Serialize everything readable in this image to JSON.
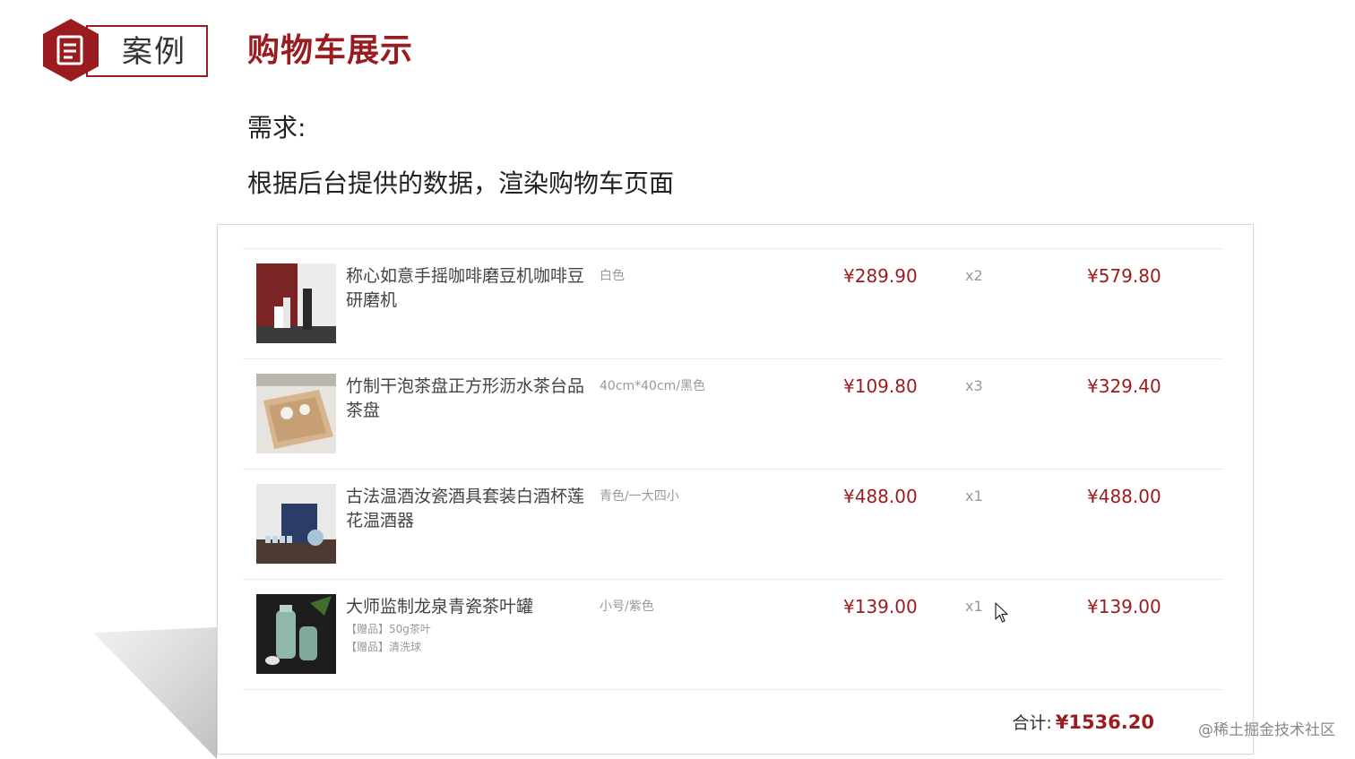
{
  "header": {
    "badge_label": "案例",
    "title": "购物车展示"
  },
  "requirement": {
    "label": "需求:",
    "text": "根据后台提供的数据，渲染购物车页面"
  },
  "cart": {
    "items": [
      {
        "name": "称心如意手摇咖啡磨豆机咖啡豆研磨机",
        "spec": "白色",
        "price": "¥289.90",
        "qty": "x2",
        "subtotal": "¥579.80",
        "gifts": []
      },
      {
        "name": "竹制干泡茶盘正方形沥水茶台品茶盘",
        "spec": "40cm*40cm/黑色",
        "price": "¥109.80",
        "qty": "x3",
        "subtotal": "¥329.40",
        "gifts": []
      },
      {
        "name": "古法温酒汝瓷酒具套装白酒杯莲花温酒器",
        "spec": "青色/一大四小",
        "price": "¥488.00",
        "qty": "x1",
        "subtotal": "¥488.00",
        "gifts": []
      },
      {
        "name": "大师监制龙泉青瓷茶叶罐",
        "spec": "小号/紫色",
        "price": "¥139.00",
        "qty": "x1",
        "subtotal": "¥139.00",
        "gifts": [
          "【赠品】50g茶叶",
          "【赠品】清洗球"
        ]
      }
    ],
    "total_label": "合计:",
    "total_value": "¥1536.20"
  },
  "watermark": "@稀土掘金技术社区",
  "colors": {
    "accent": "#9b1c1f",
    "text": "#444444",
    "muted": "#999999"
  },
  "icons": {
    "badge": "document-icon",
    "cursor": "mouse-pointer-icon"
  }
}
